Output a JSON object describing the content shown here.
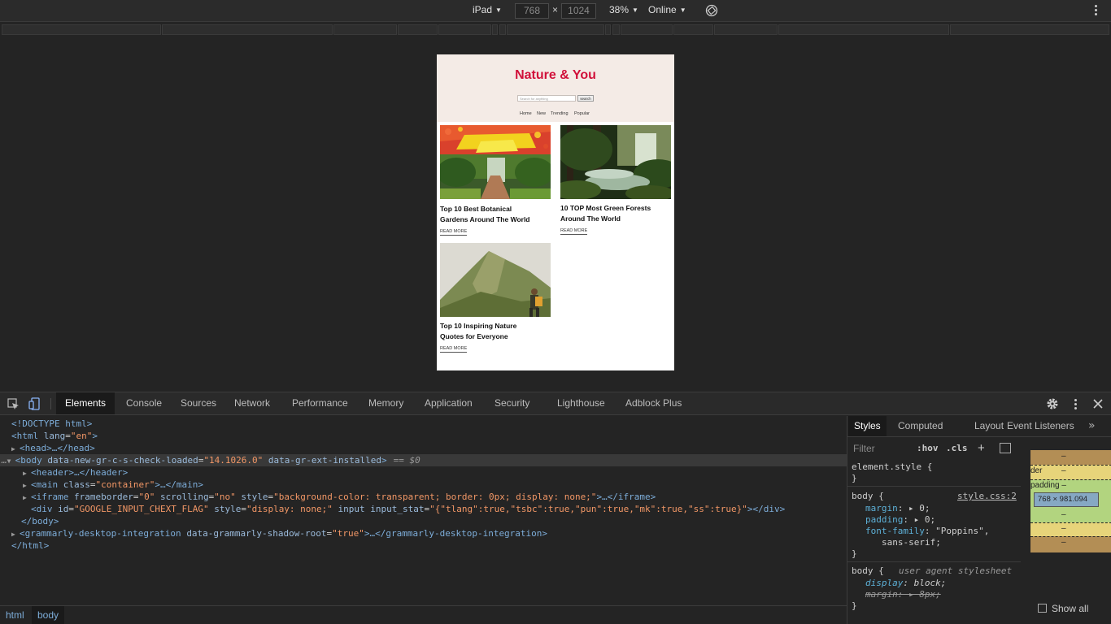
{
  "device_toolbar": {
    "device": "iPad",
    "width": "768",
    "height": "1024",
    "times": "×",
    "zoom": "38%",
    "network": "Online",
    "caret": "▼"
  },
  "site": {
    "title": "Nature & You",
    "search_placeholder": "Search for anything",
    "search_button": "search",
    "nav": [
      "Home",
      "New",
      "Trending",
      "Popular"
    ],
    "cards": [
      {
        "title_line1": "Top 10 Best Botanical",
        "title_line2": "Gardens Around The World",
        "read_more": "READ MORE"
      },
      {
        "title_line1": "10 TOP Most Green Forests",
        "title_line2": "Around The World",
        "read_more": "READ MORE"
      },
      {
        "title_line1": "Top 10 Inspiring Nature",
        "title_line2": "Quotes for Everyone",
        "read_more": "READ MORE"
      }
    ]
  },
  "devtools": {
    "tabs": [
      "Elements",
      "Console",
      "Sources",
      "Network",
      "Performance",
      "Memory",
      "Application",
      "Security",
      "Lighthouse",
      "Adblock Plus"
    ],
    "active_tab": "Elements",
    "dom": {
      "l1": "<!DOCTYPE html>",
      "l2_a": "<html ",
      "l2_attr": "lang",
      "l2_val": "\"en\"",
      "l2_b": ">",
      "l3": "<head>…</head>",
      "l4_open": "<body ",
      "l4_attr1": "data-new-gr-c-s-check-loaded",
      "l4_val1": "\"14.1026.0\"",
      "l4_attr2": "data-gr-ext-installed",
      "l4_close": ">",
      "l4_eq": "== $0",
      "l5": "<header>…</header>",
      "l6_a": "<main ",
      "l6_attr": "class",
      "l6_val": "\"container\"",
      "l6_b": ">…</main>",
      "l7_a": "<iframe ",
      "l7_attr1": "frameborder",
      "l7_val1": "\"0\"",
      "l7_attr2": "scrolling",
      "l7_val2": "\"no\"",
      "l7_attr3": "style",
      "l7_val3": "\"background-color: transparent; border: 0px; display: none;\"",
      "l7_b": ">…</iframe>",
      "l8_a": "<div ",
      "l8_attr1": "id",
      "l8_val1": "\"GOOGLE_INPUT_CHEXT_FLAG\"",
      "l8_attr2": "style",
      "l8_val2": "\"display: none;\"",
      "l8_attr3": "input",
      "l8_attr4": "input_stat",
      "l8_val4": "\"{\"tlang\":true,\"tsbc\":true,\"pun\":true,\"mk\":true,\"ss\":true}\"",
      "l8_b": "></div>",
      "l9": "</body>",
      "l10_a": "<grammarly-desktop-integration ",
      "l10_attr": "data-grammarly-shadow-root",
      "l10_val": "\"true\"",
      "l10_b": ">…</grammarly-desktop-integration>",
      "l11": "</html>"
    },
    "breadcrumbs": [
      "html",
      "body"
    ],
    "styles_tabs": [
      "Styles",
      "Computed",
      "Layout",
      "Event Listeners"
    ],
    "filter_placeholder": "Filter",
    "hov": ":hov",
    "cls": ".cls",
    "rules": {
      "element_style": "element.style {",
      "close": "}",
      "body_sel": "body {",
      "body_src": "style.css:2",
      "margin_prop": "margin",
      "margin_val": "0;",
      "padding_prop": "padding",
      "padding_val": "0;",
      "ff_prop": "font-family",
      "ff_val1": "\"Poppins\",",
      "ff_val2": "sans-serif;",
      "ua_label": "user agent stylesheet",
      "display_prop": "display",
      "display_val": "block;",
      "ua_margin": "margin: ▸ 8px;"
    },
    "box_model": {
      "border_label": "der",
      "padding_label": "padding –",
      "dash": "–",
      "content_size": "768 × 981.094"
    },
    "show_all": "Show all"
  }
}
